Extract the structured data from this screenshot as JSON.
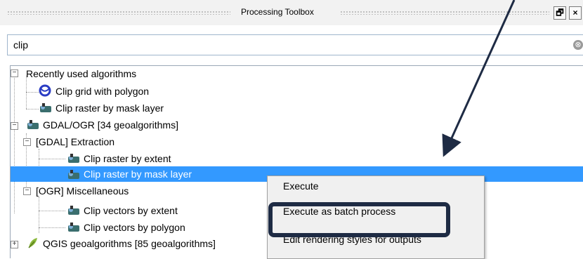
{
  "window": {
    "title": "Processing Toolbox",
    "float_button": "🗗",
    "close_button": "×"
  },
  "search": {
    "value": "clip",
    "clear_icon": "⊗"
  },
  "tree": {
    "recent": {
      "label": "Recently used algorithms",
      "items": [
        "Clip grid with polygon",
        "Clip raster by mask layer"
      ]
    },
    "gdal": {
      "label": "GDAL/OGR [34 geoalgorithms]",
      "extraction": {
        "label": "[GDAL] Extraction",
        "items": [
          "Clip raster by extent",
          "Clip raster by mask layer"
        ]
      },
      "misc": {
        "label": "[OGR] Miscellaneous",
        "items": [
          "Clip vectors by extent",
          "Clip vectors by polygon"
        ]
      }
    },
    "qgis": {
      "label": "QGIS geoalgorithms [85 geoalgorithms]"
    }
  },
  "context_menu": {
    "items": [
      "Execute",
      "Execute as batch process",
      "Edit rendering styles for outputs"
    ]
  },
  "colors": {
    "selection": "#3399ff",
    "highlight_border": "#1e2b44",
    "arrow": "#1e2b44"
  }
}
